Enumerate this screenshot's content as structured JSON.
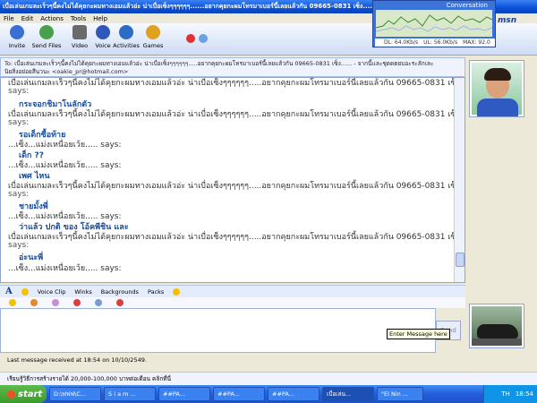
{
  "window": {
    "title": "เบื่อเล่นเกมละเร็วๆนี้คงไม่ได้คุยกะผมทางเอมแล้วอ่ะ น่าเบื่อเซ็งๆๆๆๆๆๆ......อยากคุยกะผมโทรมาเบอร์นี้เลยแล้วกัน 09665-0831 เซ็ง....."
  },
  "menu": [
    "File",
    "Edit",
    "Actions",
    "Tools",
    "Help"
  ],
  "toolbar": {
    "buttons": [
      {
        "label": "Invite",
        "color": "#3a6fd6"
      },
      {
        "label": "Send Files",
        "color": "#4aa04a"
      },
      {
        "label": "Video",
        "color": "#6a6a6a"
      },
      {
        "label": "Voice",
        "color": "#2f58b8"
      },
      {
        "label": "Activities",
        "color": "#2b6cc6"
      },
      {
        "label": "Games",
        "color": "#e0a020"
      }
    ]
  },
  "graph": {
    "header": "Conversation",
    "dl": "DL: 64.0Kb/s",
    "ul": "UL: 56.0Kb/s",
    "max": "MAX: 92.0"
  },
  "msn_logo": "msn",
  "to": {
    "line1": "To:  เบื่อเล่นเกมละเร็วๆนี้คงไม่ได้คุยกะผมทางเอมแล้วอ่ะ น่าเบื่อเซ็งๆๆๆๆๆๆ.....อยากคุยกะผมโทรมาเบอร์นี้เลยแล้วกัน 09665-0831 เซ็ง...... - จากนี้เเละชุดดตยบอะระลักเละ",
    "line2": "นิยสิ่งอย่อยสีนวนะ <oakie_pr@hotmail.com>"
  },
  "conversation": [
    {
      "type": "msg",
      "text": "เบื่อเล่นเกมละเร็วๆนี้คงไม่ได้คุยกะผมทางเอมแล้วอ่ะ น่าเบื่อเซ็งๆๆๆๆๆๆ.....อยากคุยกะผมโทรมาเบอร์นี้เลยแล้วกัน 09665-0831 เซ็ง......"
    },
    {
      "type": "says",
      "text": "says:"
    },
    {
      "type": "nick",
      "text": "กระจอกชิมาโนลักตัว"
    },
    {
      "type": "msg",
      "text": "เบื่อเล่นเกมละเร็วๆนี้คงไม่ได้คุยกะผมทางเอมแล้วอ่ะ น่าเบื่อเซ็งๆๆๆๆๆๆ.....อยากคุยกะผมโทรมาเบอร์นี้เลยแล้วกัน 09665-0831 เซ็ง......"
    },
    {
      "type": "says",
      "text": "says:"
    },
    {
      "type": "nick",
      "text": "รอเด็กซื้อท้าย"
    },
    {
      "type": "msg",
      "text": "...เซ็ง...แม่งเหนื่อยเว้ย..... says:"
    },
    {
      "type": "nick",
      "text": "เด็ก ??"
    },
    {
      "type": "msg",
      "text": "...เซ็ง...แม่งเหนื่อยเว้ย..... says:"
    },
    {
      "type": "nick",
      "text": "เพศ ไหน"
    },
    {
      "type": "msg",
      "text": "เบื่อเล่นเกมละเร็วๆนี้คงไม่ได้คุยกะผมทางเอมแล้วอ่ะ น่าเบื่อเซ็งๆๆๆๆๆๆ.....อยากคุยกะผมโทรมาเบอร์นี้เลยแล้วกัน 09665-0831 เซ็ง......"
    },
    {
      "type": "says",
      "text": "says:"
    },
    {
      "type": "nick",
      "text": "ชายมั้งพี่"
    },
    {
      "type": "msg",
      "text": "...เซ็ง...แม่งเหนื่อยเว้ย..... says:"
    },
    {
      "type": "nick",
      "text": "ว่าแล้ว ปกติ ของ โอ้คพีชิน และ"
    },
    {
      "type": "msg",
      "text": "เบื่อเล่นเกมละเร็วๆนี้คงไม่ได้คุยกะผมทางเอมแล้วอ่ะ น่าเบื่อเซ็งๆๆๆๆๆๆ.....อยากคุยกะผมโทรมาเบอร์นี้เลยแล้วกัน 09665-0831 เซ็ง......"
    },
    {
      "type": "says",
      "text": "says:"
    },
    {
      "type": "nick",
      "text": "อ่ะนะพี่"
    },
    {
      "type": "msg",
      "text": "...เซ็ง...แม่งเหนื่อยเว้ย..... says:"
    }
  ],
  "format_bar": {
    "font_label": "A",
    "voice_clip": "Voice Clip",
    "winks": "Winks",
    "backgrounds": "Backgrounds",
    "packs": "Packs"
  },
  "input": {
    "send_label": "Send",
    "tooltip": "Enter Message here"
  },
  "status": {
    "last_message": "Last message received at 18:54 on 10/10/2549."
  },
  "ad": {
    "text": "เรียนรู้วิธีการสร้างรายได้ 20,000-100,000 บาทต่อเดือน คลิกที่นี่"
  },
  "taskbar": {
    "start": "start",
    "tasks": [
      {
        "label": "D:\\ฟฟฟ\\C...",
        "active": false
      },
      {
        "label": "S i a m ...",
        "active": false
      },
      {
        "label": "##PA...",
        "active": false
      },
      {
        "label": "##PA...",
        "active": false
      },
      {
        "label": "##PA...",
        "active": false
      },
      {
        "label": "เบื่อเล่น...",
        "active": true
      },
      {
        "label": "\"El Nin ...",
        "active": false
      }
    ],
    "lang": "TH",
    "time": "18:54"
  }
}
